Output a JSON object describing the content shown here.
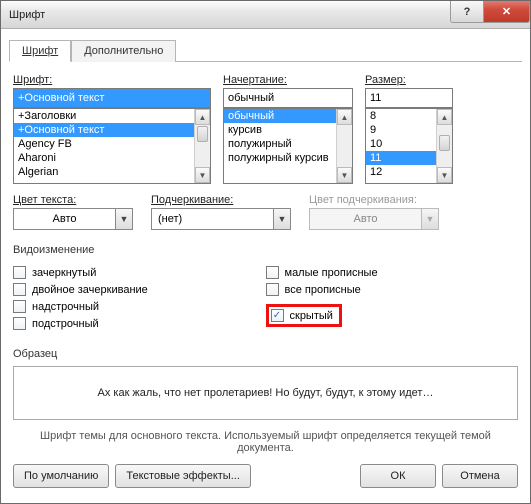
{
  "window": {
    "title": "Шрифт"
  },
  "tabs": {
    "font": "Шрифт",
    "advanced": "Дополнительно"
  },
  "font_section": {
    "label": "Шрифт:",
    "value": "+Основной текст",
    "options": [
      "+Заголовки",
      "+Основной текст",
      "Agency FB",
      "Aharoni",
      "Algerian"
    ]
  },
  "style_section": {
    "label": "Начертание:",
    "value": "обычный",
    "options": [
      "обычный",
      "курсив",
      "полужирный",
      "полужирный курсив"
    ]
  },
  "size_section": {
    "label": "Размер:",
    "value": "11",
    "options": [
      "8",
      "9",
      "10",
      "11",
      "12"
    ]
  },
  "color_row": {
    "font_color_label": "Цвет текста:",
    "font_color_value": "Авто",
    "underline_label": "Подчеркивание:",
    "underline_value": "(нет)",
    "underline_color_label": "Цвет подчеркивания:",
    "underline_color_value": "Авто"
  },
  "effects": {
    "title": "Видоизменение",
    "strike": "зачеркнутый",
    "dblstrike": "двойное зачеркивание",
    "superscript": "надстрочный",
    "subscript": "подстрочный",
    "smallcaps": "малые прописные",
    "allcaps": "все прописные",
    "hidden": "скрытый"
  },
  "preview": {
    "title": "Образец",
    "text": "Ах  как  жаль,  что нет пролетариев! Но будут, будут, к этому идет…"
  },
  "hint": "Шрифт темы для основного текста. Используемый шрифт определяется текущей темой документа.",
  "buttons": {
    "default": "По умолчанию",
    "text_effects": "Текстовые эффекты...",
    "ok": "ОК",
    "cancel": "Отмена"
  }
}
